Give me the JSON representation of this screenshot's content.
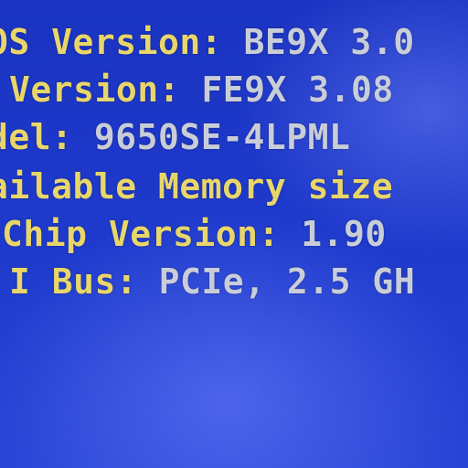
{
  "colors": {
    "background": "#1b35c4",
    "label": "#e8d66a",
    "value": "#c9cdd8"
  },
  "lines": [
    {
      "label": "OS Version: ",
      "value": "BE9X 3.0"
    },
    {
      "label": "Version: ",
      "value": "FE9X 3.08"
    },
    {
      "label": "del: ",
      "value": "9650SE-4LPML"
    },
    {
      "label": "ailable Memory size",
      "value": ""
    },
    {
      "label": "Chip Version: ",
      "value": "1.90"
    },
    {
      "label": "I Bus: ",
      "value": "PCIe, 2.5 GH"
    }
  ]
}
